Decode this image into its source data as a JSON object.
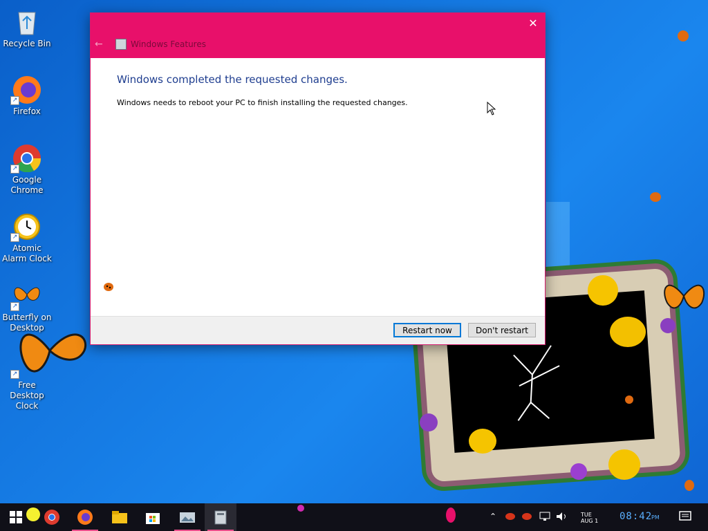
{
  "desktop": {
    "icons": [
      {
        "label": "Recycle Bin"
      },
      {
        "label": "Firefox"
      },
      {
        "label": "Google Chrome"
      },
      {
        "label": "Atomic Alarm Clock"
      },
      {
        "label": "Butterfly on Desktop"
      },
      {
        "label": "Free Desktop Clock"
      }
    ]
  },
  "dialog": {
    "title": "Windows Features",
    "heading": "Windows completed the requested changes.",
    "message": "Windows needs to reboot your PC to finish installing the requested changes.",
    "buttons": {
      "restart_now": "Restart now",
      "dont_restart": "Don't restart"
    },
    "accent_color": "#e8106a"
  },
  "taskbar": {
    "apps": [
      "start-icon",
      "chrome-icon",
      "firefox-icon",
      "file-explorer-icon",
      "store-icon",
      "image-viewer-icon",
      "windows-features-icon"
    ],
    "tray": {
      "day": "TUE",
      "date": "AUG 1",
      "time": "08:42",
      "ampm": "PM"
    }
  }
}
